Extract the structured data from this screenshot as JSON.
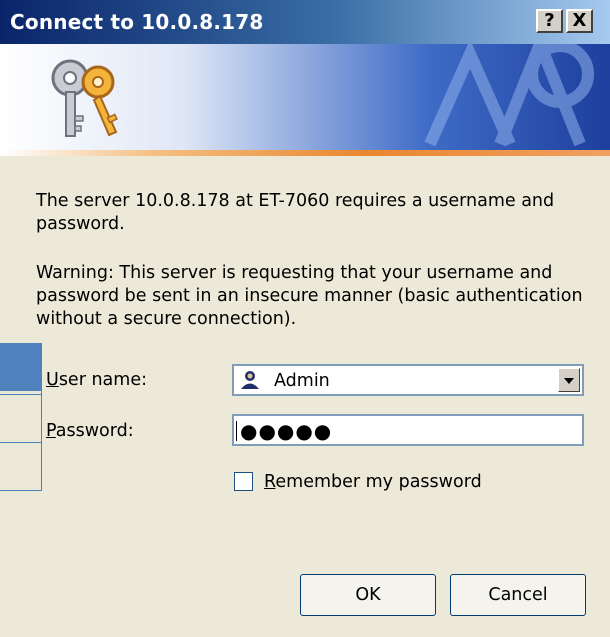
{
  "window": {
    "title": "Connect to 10.0.8.178",
    "help_label": "?",
    "close_label": "X"
  },
  "message": {
    "intro": "The server 10.0.8.178 at ET-7060 requires a username and password.",
    "warning": "Warning: This server is requesting that your username and password be sent in an insecure manner (basic authentication without a secure connection)."
  },
  "form": {
    "username_label_first": "U",
    "username_label_rest": "ser name:",
    "username_value": "Admin",
    "password_label_first": "P",
    "password_label_rest": "assword:",
    "password_mask": "●●●●●",
    "remember_label_first": "R",
    "remember_label_rest": "emember my password",
    "remember_checked": false
  },
  "buttons": {
    "ok": "OK",
    "cancel": "Cancel"
  },
  "icons": [
    "keys-icon",
    "user-icon",
    "dropdown-arrow-icon",
    "help-icon",
    "close-icon"
  ],
  "colors": {
    "titlebar": "#0a246a",
    "dialog_bg": "#ece9d8",
    "overlay_blue": "#4f81bd"
  }
}
